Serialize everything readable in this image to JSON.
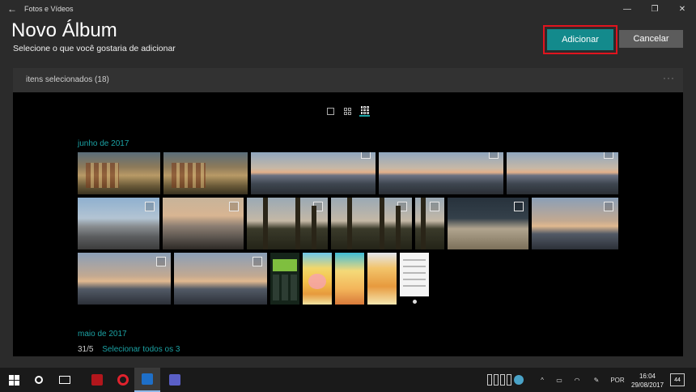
{
  "window": {
    "title": "Fotos e Vídeos",
    "back_icon": "←",
    "minimize": "—",
    "maximize": "❐",
    "close": "✕"
  },
  "header": {
    "title": "Novo Álbum",
    "subtitle": "Selecione o que você gostaria de adicionar",
    "add_label": "Adicionar",
    "cancel_label": "Cancelar"
  },
  "selection": {
    "label": "itens selecionados (18)",
    "more": "···"
  },
  "gallery": {
    "month_june": "junho de 2017",
    "month_may": "maio de 2017",
    "date": "31/5",
    "select_all": "Selecionar todos os 3"
  },
  "taskbar": {
    "language": "POR",
    "time": "16:04",
    "date": "29/08/2017",
    "notifications": "44",
    "accent_color": "#138a8c"
  }
}
